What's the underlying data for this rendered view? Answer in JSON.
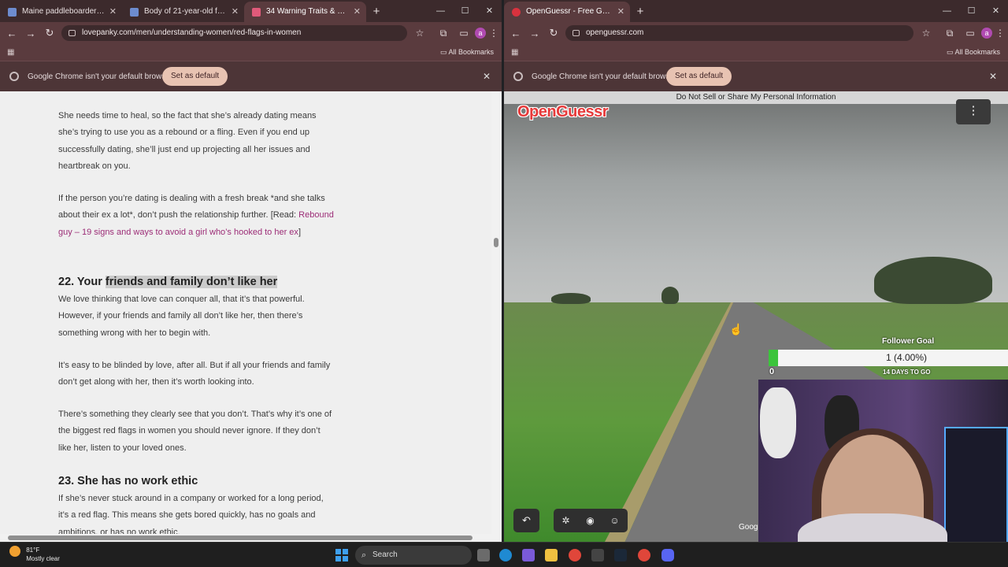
{
  "left_browser": {
    "tabs": [
      {
        "title": "Maine paddleboarder murder ..."
      },
      {
        "title": "Body of 21-year-old found in M..."
      },
      {
        "title": "34 Warning Traits & Red Flags ..."
      }
    ],
    "url": "lovepanky.com/men/understanding-women/red-flags-in-women",
    "bookmarks_label": "All Bookmarks",
    "infobar_message": "Google Chrome isn't your default browser",
    "infobar_button": "Set as default"
  },
  "article": {
    "p1": "She needs time to heal, so the fact that she’s already dating means she’s trying to use you as a rebound or a fling. Even if you end up successfully dating, she’ll just end up projecting all her issues and heartbreak on you.",
    "p2": "If the person you’re dating is dealing with a fresh break *and she talks about their ex a lot*, don’t push the relationship further.",
    "read_prefix": "[Read: ",
    "read_link": "Rebound guy – 19 signs and ways to avoid a girl who’s hooked to her ex",
    "read_suffix": "]",
    "h22_prefix": "22. Your ",
    "h22_highlight": "friends and family don’t like her",
    "p3": "We love thinking that love can conquer all, that it’s that powerful. However, if your friends and family all don’t like her, then there’s something wrong with her to begin with.",
    "p4": "It’s easy to be blinded by love, after all. But if all your friends and family don’t get along with her, then it’s worth looking into.",
    "p5": "There’s something they clearly see that you don’t. That’s why it’s one of the biggest red flags in women you should never ignore. If they don’t like her, listen to your loved ones.",
    "h23": "23. She has no work ethic",
    "p6": "If she’s never stuck around in a company or worked for a long period, it’s a red flag. This means she gets bored quickly, has no goals and ambitions, or has no work ethic."
  },
  "right_browser": {
    "tabs": [
      {
        "title": "OpenGuessr - Free GeoGue..."
      }
    ],
    "url": "openguessr.com",
    "bookmarks_label": "All Bookmarks",
    "infobar_message": "Google Chrome isn't your default browser",
    "infobar_button": "Set as default"
  },
  "game": {
    "privacy_link": "Do Not Sell or Share My Personal Information",
    "logo": "OpenGuessr",
    "attribution": "Goog",
    "controls": [
      "undo-icon",
      "bug-icon",
      "discord-icon",
      "reddit-icon"
    ]
  },
  "follower_goal": {
    "title": "Follower Goal",
    "value_text": "1 (4.00%)",
    "progress": 0.04,
    "min": "0",
    "days_left": "14 DAYS TO GO"
  },
  "taskbar": {
    "temperature": "81°F",
    "condition": "Mostly clear",
    "search_placeholder": "Search"
  },
  "colors": {
    "chrome_frame": "#3c2a2c",
    "chrome_toolbar": "#5a3b3e",
    "link": "#9c2d77",
    "goal_fill": "#3cc43c"
  }
}
